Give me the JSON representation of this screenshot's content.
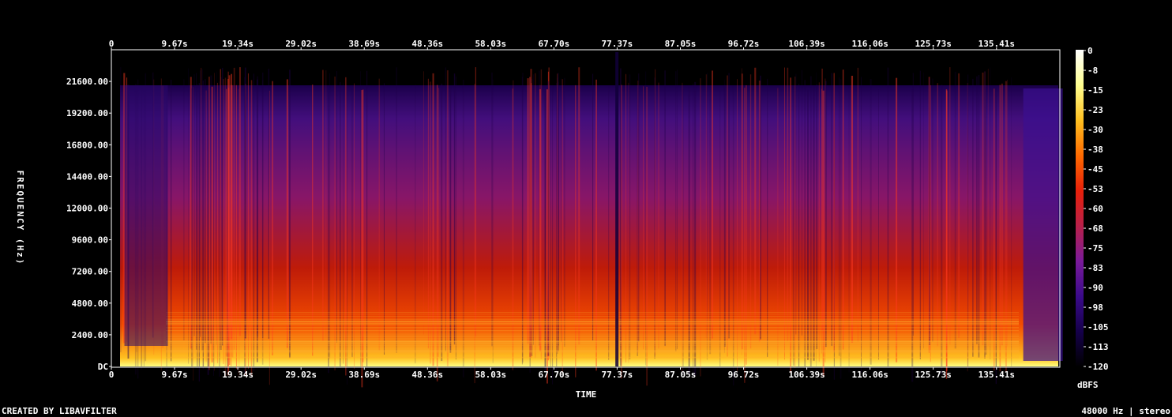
{
  "chart_data": {
    "type": "heatmap",
    "xlabel": "TIME",
    "ylabel": "FREQUENCY (Hz)",
    "colorbar_label": "dBFS",
    "x_ticks": [
      "0",
      "9.67s",
      "19.34s",
      "29.02s",
      "38.69s",
      "48.36s",
      "58.03s",
      "67.70s",
      "77.37s",
      "87.05s",
      "96.72s",
      "106.39s",
      "116.06s",
      "125.73s",
      "135.41s"
    ],
    "x_tick_values": [
      0,
      9.67,
      19.34,
      29.02,
      38.69,
      48.36,
      58.03,
      67.7,
      77.37,
      87.05,
      96.72,
      106.39,
      116.06,
      125.73,
      135.41
    ],
    "xlim": [
      0,
      145.1
    ],
    "y_ticks": [
      "DC",
      "2400.00",
      "4800.00",
      "7200.00",
      "9600.00",
      "12000.00",
      "14400.00",
      "16800.00",
      "19200.00",
      "21600.00"
    ],
    "y_tick_values": [
      0,
      2400,
      4800,
      7200,
      9600,
      12000,
      14400,
      16800,
      19200,
      21600
    ],
    "ylim": [
      0,
      24000
    ],
    "colorbar_ticks": [
      "0",
      "-8",
      "-15",
      "-23",
      "-30",
      "-38",
      "-45",
      "-53",
      "-60",
      "-68",
      "-75",
      "-83",
      "-90",
      "-98",
      "-105",
      "-113",
      "-120"
    ],
    "colorbar_range": [
      -120,
      0
    ],
    "colormap": [
      "#000000",
      "#15004a",
      "#3a0a8a",
      "#7a1a9a",
      "#b8204a",
      "#e8200a",
      "#ff6a00",
      "#ffc020",
      "#ffff90",
      "#ffffff"
    ]
  },
  "footer": {
    "left": "CREATED BY LIBAVFILTER",
    "right": "48000 Hz | stereo"
  }
}
